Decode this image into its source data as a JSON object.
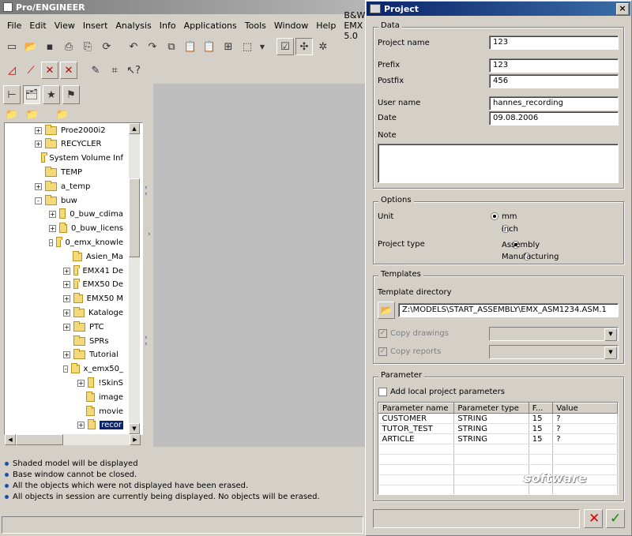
{
  "proe": {
    "title": "Pro/ENGINEER",
    "menu": [
      "File",
      "Edit",
      "View",
      "Insert",
      "Analysis",
      "Info",
      "Applications",
      "Tools",
      "Window",
      "Help",
      "B&W EMX 5.0"
    ],
    "tree": [
      {
        "label": "Proe2000i2",
        "expander": "+"
      },
      {
        "label": "RECYCLER",
        "expander": "+"
      },
      {
        "label": "System Volume Inf",
        "expander": ""
      },
      {
        "label": "TEMP",
        "expander": ""
      },
      {
        "label": "a_temp",
        "expander": "+"
      },
      {
        "label": "buw",
        "expander": "-"
      },
      {
        "label": "0_buw_cdima",
        "expander": "+"
      },
      {
        "label": "0_buw_licens",
        "expander": "+"
      },
      {
        "label": "0_emx_knowle",
        "expander": "-"
      },
      {
        "label": "Asien_Ma",
        "expander": ""
      },
      {
        "label": "EMX41 De",
        "expander": "+"
      },
      {
        "label": "EMX50 De",
        "expander": "+"
      },
      {
        "label": "EMX50 M",
        "expander": "+"
      },
      {
        "label": "Kataloge",
        "expander": "+"
      },
      {
        "label": "PTC",
        "expander": "+"
      },
      {
        "label": "SPRs",
        "expander": ""
      },
      {
        "label": "Tutorial",
        "expander": "+"
      },
      {
        "label": "x_emx50_",
        "expander": "-"
      },
      {
        "label": "!SkinS",
        "expander": "+"
      },
      {
        "label": "image",
        "expander": ""
      },
      {
        "label": "movie",
        "expander": ""
      },
      {
        "label": "recor",
        "expander": "+"
      }
    ],
    "messages": [
      "Shaded model will be displayed",
      "Base window cannot be closed.",
      "All the objects which were not displayed have been erased.",
      "All objects in session are currently being displayed. No objects will be erased."
    ]
  },
  "dialog": {
    "title": "Project",
    "close_glyph": "×",
    "data_group": "Data",
    "project_name_label": "Project name",
    "project_name": "123",
    "prefix_label": "Prefix",
    "prefix": "123",
    "postfix_label": "Postfix",
    "postfix": "456",
    "user_name_label": "User name",
    "user_name": "hannes_recording",
    "date_label": "Date",
    "date": "09.08.2006",
    "note_label": "Note",
    "note": "",
    "options_group": "Options",
    "unit_label": "Unit",
    "unit_mm": "mm",
    "unit_inch": "inch",
    "project_type_label": "Project type",
    "type_assembly": "Assembly",
    "type_manufacturing": "Manufacturing",
    "templates_group": "Templates",
    "template_dir_label": "Template directory",
    "template_dir": "Z:\\MODELS\\START_ASSEMBLY\\EMX_ASM1234.ASM.1",
    "copy_drawings": "Copy drawings",
    "copy_reports": "Copy reports",
    "parameter_group": "Parameter",
    "add_local_params": "Add local project parameters",
    "param_headers": [
      "Parameter name",
      "Parameter type",
      "F...",
      "Value"
    ],
    "params": [
      [
        "CUSTOMER",
        "STRING",
        "15",
        "?"
      ],
      [
        "TUTOR_TEST",
        "STRING",
        "15",
        "?"
      ],
      [
        "ARTICLE",
        "STRING",
        "15",
        "?"
      ]
    ],
    "watermark": "software"
  }
}
